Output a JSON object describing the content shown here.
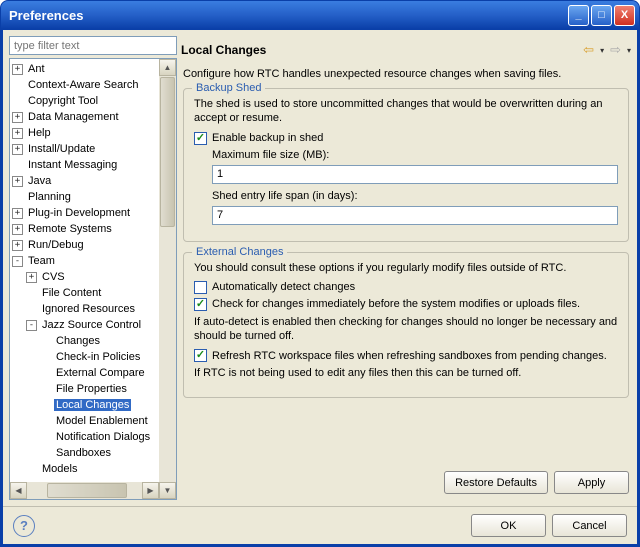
{
  "window": {
    "title": "Preferences"
  },
  "filter": {
    "placeholder": "type filter text"
  },
  "tree": [
    {
      "label": "Ant",
      "toggle": "+",
      "indent": 0
    },
    {
      "label": "Context-Aware Search",
      "toggle": "",
      "indent": 0
    },
    {
      "label": "Copyright Tool",
      "toggle": "",
      "indent": 0
    },
    {
      "label": "Data Management",
      "toggle": "+",
      "indent": 0
    },
    {
      "label": "Help",
      "toggle": "+",
      "indent": 0
    },
    {
      "label": "Install/Update",
      "toggle": "+",
      "indent": 0
    },
    {
      "label": "Instant Messaging",
      "toggle": "",
      "indent": 0
    },
    {
      "label": "Java",
      "toggle": "+",
      "indent": 0
    },
    {
      "label": "Planning",
      "toggle": "",
      "indent": 0
    },
    {
      "label": "Plug-in Development",
      "toggle": "+",
      "indent": 0
    },
    {
      "label": "Remote Systems",
      "toggle": "+",
      "indent": 0
    },
    {
      "label": "Run/Debug",
      "toggle": "+",
      "indent": 0
    },
    {
      "label": "Team",
      "toggle": "-",
      "indent": 0
    },
    {
      "label": "CVS",
      "toggle": "+",
      "indent": 1
    },
    {
      "label": "File Content",
      "toggle": "",
      "indent": 1
    },
    {
      "label": "Ignored Resources",
      "toggle": "",
      "indent": 1
    },
    {
      "label": "Jazz Source Control",
      "toggle": "-",
      "indent": 1
    },
    {
      "label": "Changes",
      "toggle": "",
      "indent": 2
    },
    {
      "label": "Check-in Policies",
      "toggle": "",
      "indent": 2
    },
    {
      "label": "External Compare",
      "toggle": "",
      "indent": 2
    },
    {
      "label": "File Properties",
      "toggle": "",
      "indent": 2
    },
    {
      "label": "Local Changes",
      "toggle": "",
      "indent": 2,
      "selected": true
    },
    {
      "label": "Model Enablement",
      "toggle": "",
      "indent": 2
    },
    {
      "label": "Notification Dialogs",
      "toggle": "",
      "indent": 2
    },
    {
      "label": "Sandboxes",
      "toggle": "",
      "indent": 2
    },
    {
      "label": "Models",
      "toggle": "",
      "indent": 1
    }
  ],
  "page": {
    "title": "Local Changes",
    "description": "Configure how RTC handles unexpected resource changes when saving files."
  },
  "backup": {
    "title": "Backup Shed",
    "info": "The shed is used to store uncommitted changes that would be overwritten during an accept or resume.",
    "enable_label": "Enable backup in shed",
    "enable_checked": true,
    "max_label": "Maximum file size (MB):",
    "max_value": "1",
    "life_label": "Shed entry life span (in days):",
    "life_value": "7"
  },
  "external": {
    "title": "External Changes",
    "info": "You should consult these options if you regularly modify files outside of RTC.",
    "auto_label": "Automatically detect changes",
    "auto_checked": false,
    "check_label": "Check for changes immediately before the system modifies or uploads files.",
    "check_checked": true,
    "check_note": "If auto-detect is enabled then checking for changes should no longer be necessary and should be turned off.",
    "refresh_label": "Refresh RTC workspace files when refreshing sandboxes from pending changes.",
    "refresh_checked": true,
    "refresh_note": "If RTC is not being used to edit any files then this can be turned off."
  },
  "buttons": {
    "restore": "Restore Defaults",
    "apply": "Apply",
    "ok": "OK",
    "cancel": "Cancel"
  }
}
